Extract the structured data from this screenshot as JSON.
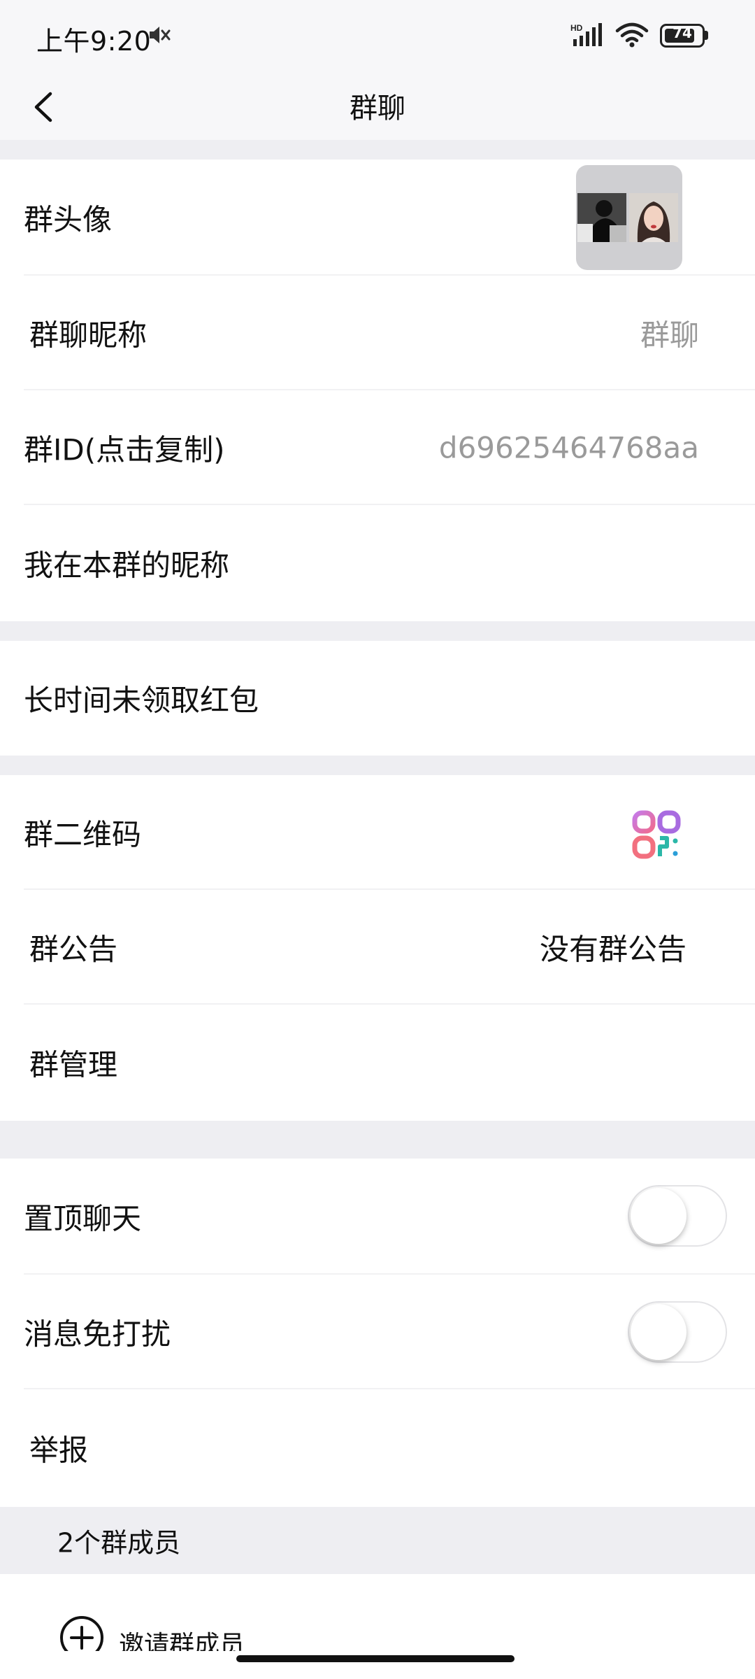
{
  "status_bar": {
    "time": "上午9:20",
    "battery_level": "74",
    "icons": [
      "mute-icon",
      "hd-signal-icon",
      "wifi-icon",
      "battery-icon"
    ]
  },
  "header": {
    "title": "群聊",
    "back_icon": "chevron-left-icon"
  },
  "group_info": {
    "avatar_label": "群头像",
    "nickname_label": "群聊昵称",
    "nickname_value": "群聊",
    "id_label": "群ID(点击复制)",
    "id_value": "d69625464768aa",
    "my_nickname_label": "我在本群的昵称"
  },
  "red_packet": {
    "label": "长时间未领取红包"
  },
  "manage": {
    "qr_label": "群二维码",
    "qr_icon": "qr-code-icon",
    "announcement_label": "群公告",
    "announcement_value": "没有群公告",
    "management_label": "群管理"
  },
  "settings": {
    "pin_label": "置顶聊天",
    "pin_enabled": false,
    "mute_label": "消息免打扰",
    "mute_enabled": false,
    "report_label": "举报"
  },
  "members": {
    "header": "2个群成员",
    "invite_label": "邀请群成员",
    "invite_icon": "plus-circle-icon"
  },
  "colors": {
    "background": "#ffffff",
    "section_gap": "#eeeef2",
    "bar_background": "#f7f7f9",
    "secondary_text": "#9a9a9a"
  }
}
